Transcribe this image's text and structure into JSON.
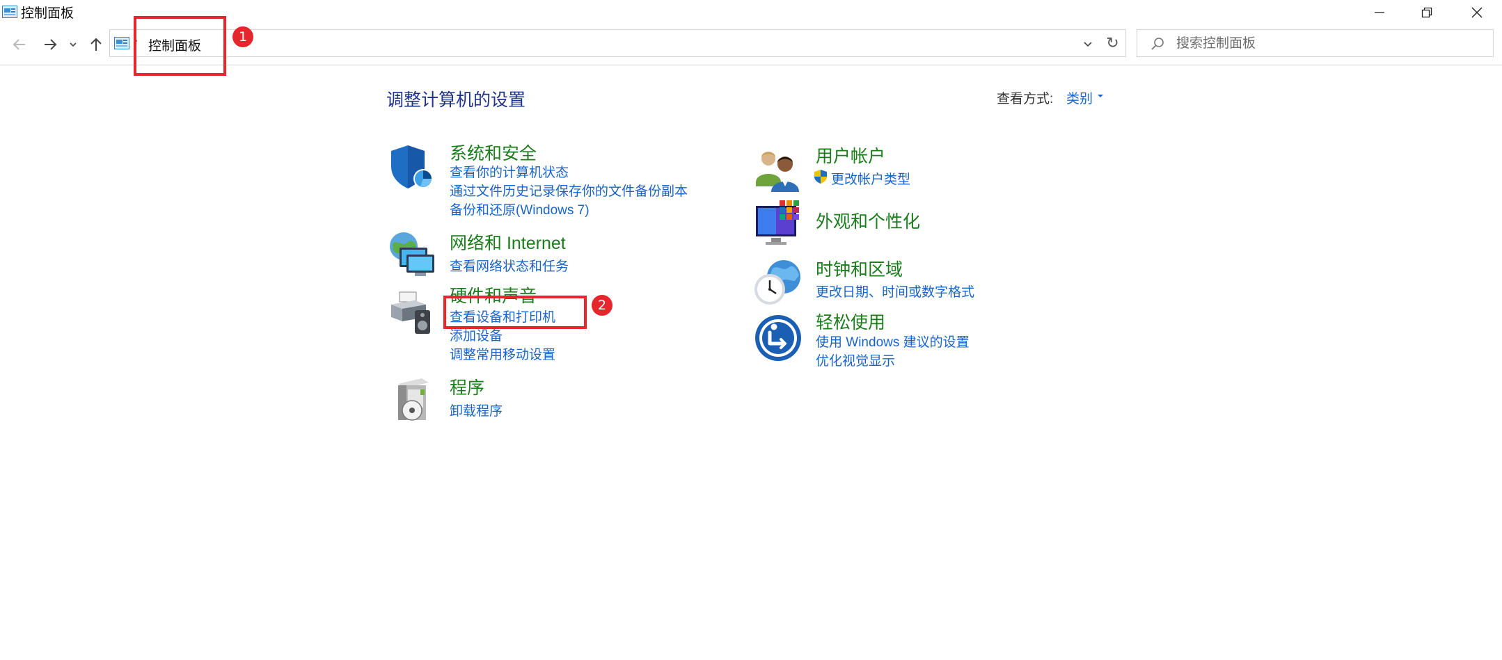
{
  "window": {
    "title": "控制面板",
    "minimize_icon": "minimize-icon",
    "maximize_icon": "restore-icon",
    "close_icon": "close-icon"
  },
  "nav": {
    "address_text": "控制面板",
    "address_separator": "›",
    "refresh_glyph": "↻",
    "search_placeholder": "搜索控制面板"
  },
  "annotations": [
    {
      "number": "1"
    },
    {
      "number": "2"
    }
  ],
  "header": {
    "title": "调整计算机的设置",
    "view_label": "查看方式:",
    "view_value": "类别"
  },
  "categories": {
    "system_security": {
      "title": "系统和安全",
      "links": [
        "查看你的计算机状态",
        "通过文件历史记录保存你的文件备份副本",
        "备份和还原(Windows 7)"
      ]
    },
    "network": {
      "title": "网络和 Internet",
      "links": [
        "查看网络状态和任务"
      ]
    },
    "hardware": {
      "title": "硬件和声音",
      "links": [
        "查看设备和打印机",
        "添加设备",
        "调整常用移动设置"
      ]
    },
    "programs": {
      "title": "程序",
      "links": [
        "卸载程序"
      ]
    },
    "user_accounts": {
      "title": "用户帐户",
      "links": [
        "更改帐户类型"
      ]
    },
    "appearance": {
      "title": "外观和个性化",
      "links": []
    },
    "clock_region": {
      "title": "时钟和区域",
      "links": [
        "更改日期、时间或数字格式"
      ]
    },
    "ease_of_access": {
      "title": "轻松使用",
      "links": [
        "使用 Windows 建议的设置",
        "优化视觉显示"
      ]
    }
  },
  "colors": {
    "category_title": "#1a7c1a",
    "link": "#1a64c8",
    "page_title": "#1e3287",
    "annotation": "#e5262d"
  }
}
